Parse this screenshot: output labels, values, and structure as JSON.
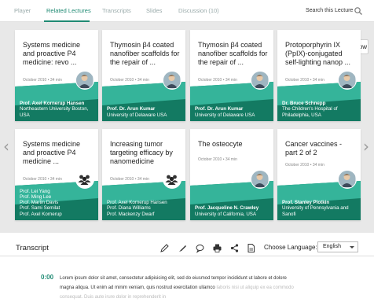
{
  "tabs": [
    "Player",
    "Related Lectures",
    "Transcripts",
    "Slides",
    "Discussion (10)"
  ],
  "active_tab": 1,
  "search": {
    "label": "Search this Lecture",
    "icon": "search-icon"
  },
  "show_button": {
    "label": "Show",
    "icon": "play-circle-icon"
  },
  "nav": {
    "prev": "‹",
    "next": "›"
  },
  "colors": {
    "accent": "#1f8a73",
    "band_light": "#35b49a",
    "band_dark": "#137a62"
  },
  "cards": [
    {
      "title": "Systems medicine and proactive P4 medicine: revo ...",
      "date": "October 2010",
      "duration": "34 min",
      "people": [
        {
          "name": "Prof. Axel Kornerup Hansen",
          "aff": "Northeastern University Boston, USA"
        }
      ],
      "avatar": "single"
    },
    {
      "title": "Thymosin β4 coated nanofiber scaffolds for the repair of ...",
      "date": "October 2010",
      "duration": "34 min",
      "people": [
        {
          "name": "Prof. Dr. Arun Kumar",
          "aff": "University of Delaware USA"
        }
      ],
      "avatar": "single"
    },
    {
      "title": "Thymosin β4 coated nanofiber scaffolds for the repair of ...",
      "date": "October 2010",
      "duration": "34 min",
      "people": [
        {
          "name": "Prof. Dr. Arun Kumar",
          "aff": "University of Delaware USA"
        }
      ],
      "avatar": "single"
    },
    {
      "title": "Protoporphyrin IX (PpIX)-conjugated self-lighting nanop ...",
      "date": "October 2010",
      "duration": "34 min",
      "people": [
        {
          "name": "Dr. Bruce Schnepp",
          "aff": "The Children's Hospital of Philadelphia, USA"
        }
      ],
      "avatar": "single"
    },
    {
      "title": "Systems medicine and proactive P4 medicine ...",
      "date": "October 2010",
      "duration": "34 min",
      "people": [
        {
          "name": "Prof. Lei Yang",
          "aff": ""
        },
        {
          "name": "Prof. Ming Lee",
          "aff": ""
        },
        {
          "name": "Prof. Martin Davis",
          "aff": ""
        },
        {
          "name": "Prof. Sami Semilat",
          "aff": ""
        },
        {
          "name": "Prof. Axel Kornerup",
          "aff": ""
        }
      ],
      "avatar": "group"
    },
    {
      "title": "Increasing tumor targeting efficacy by nanomedicine",
      "date": "October 2010",
      "duration": "34 min",
      "people": [
        {
          "name": "Prof. Axel Kornerup Hansen",
          "aff": ""
        },
        {
          "name": "Prof. Diana Williams",
          "aff": ""
        },
        {
          "name": "Prof. Mackenzy Dwarf",
          "aff": ""
        }
      ],
      "avatar": "group"
    },
    {
      "title": "The osteocyte",
      "date": "October 2010",
      "duration": "34 min",
      "people": [
        {
          "name": "Prof. Jacqueline N. Crawley",
          "aff": "University of California, USA"
        }
      ],
      "avatar": "single"
    },
    {
      "title": "Cancer vaccines - part 2 of 2",
      "date": "October 2010",
      "duration": "34 min",
      "people": [
        {
          "name": "Prof. Stanley Plotkin",
          "aff": "University of Pennsylvania and Sanofi"
        }
      ],
      "avatar": "single"
    }
  ],
  "transcript": {
    "title": "Transcript",
    "tools": [
      "pencil-icon",
      "highlighter-icon",
      "comment-icon",
      "print-icon",
      "share-icon",
      "document-icon"
    ],
    "language_label": "Choose Language:",
    "language_value": "English",
    "time": "0:00",
    "text": "Lorem ipsum dolor sit amet, consectetur adipisicing elit, sed do eiusmod tempor incididunt ut labore et dolore magna aliqua. Ut enim ad minim veniam, quis nostrud exercitation ullamco",
    "text_faded": "laboris nisi ut aliquip ex ea commodo consequat. Duis aute irure dolor in reprehenderit in"
  }
}
